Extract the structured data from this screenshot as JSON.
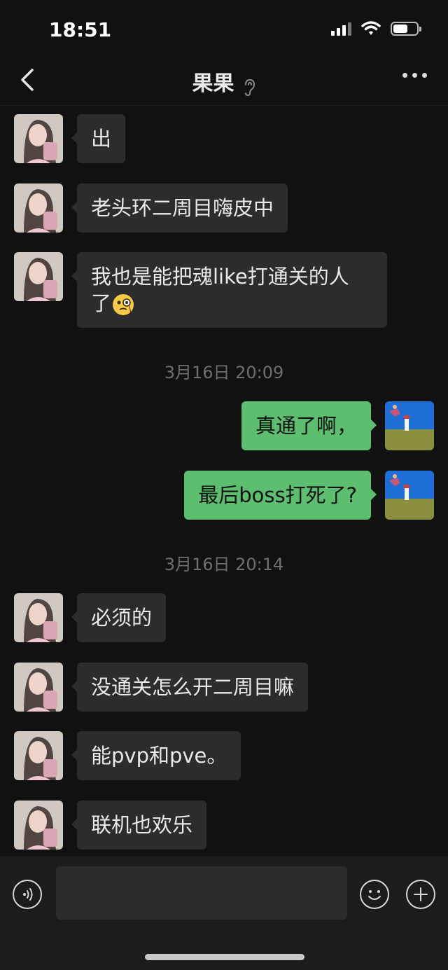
{
  "status_bar": {
    "time": "18:51"
  },
  "header": {
    "title": "果果"
  },
  "colors": {
    "background": "#111111",
    "incoming_bubble": "#2c2c2c",
    "outgoing_bubble": "#5dbe6f",
    "timestamp": "#6f6f6f"
  },
  "messages": [
    {
      "side": "left",
      "text": "出"
    },
    {
      "side": "left",
      "text": "老头环二周目嗨皮中"
    },
    {
      "side": "left",
      "text_line1": "我也是能把魂like打通关的人",
      "text_line2": "了",
      "emoji": "monocle-face"
    },
    {
      "type": "timestamp",
      "text": "3月16日 20:09"
    },
    {
      "side": "right",
      "text": "真通了啊，"
    },
    {
      "side": "right",
      "text": "最后boss打死了?"
    },
    {
      "type": "timestamp",
      "text": "3月16日 20:14"
    },
    {
      "side": "left",
      "text": "必须的"
    },
    {
      "side": "left",
      "text": "没通关怎么开二周目嘛"
    },
    {
      "side": "left",
      "text": "能pvp和pve。"
    },
    {
      "side": "left",
      "text": "联机也欢乐"
    }
  ],
  "input_bar": {
    "left_icon": "voice-icon",
    "right_icons": [
      "emoji-icon",
      "plus-icon"
    ]
  }
}
